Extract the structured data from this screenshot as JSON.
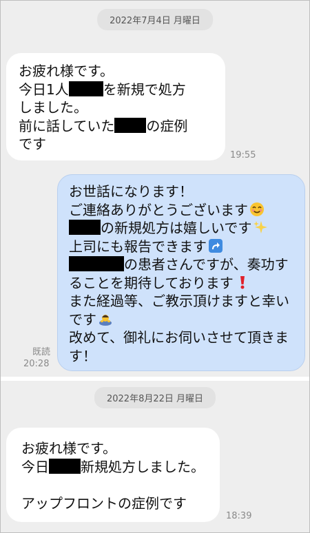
{
  "dates": {
    "first": "2022年7月4日 月曜日",
    "second": "2022年8月22日 月曜日"
  },
  "msg1": {
    "line1": "お疲れ様です。",
    "line2_pre": "今日1人",
    "line2_post": "を新規で処方",
    "line3": "しました。",
    "line4_pre": "前に話していた",
    "line4_post": "の症例",
    "line5": "です",
    "time": "19:55"
  },
  "msg2": {
    "line1": "お世話になります！",
    "line2": "ご連絡ありがとうございます",
    "line3_post": "の新規処方は嬉しいです",
    "line4": "上司にも報告できます",
    "line5_post": "の患者さんですが、奏功す",
    "line6": "ることを期待しております",
    "line7": "また経過等、ご教示頂けますと幸い",
    "line8": "です",
    "line9": "改めて、御礼にお伺いさせて頂きま",
    "line10": "す！",
    "read_label": "既読",
    "time": "20:28"
  },
  "msg3": {
    "line1": "お疲れ様です。",
    "line2_pre": "今日",
    "line2_post": "新規処方しました。",
    "line4": "アップフロントの症例です",
    "time": "18:39"
  },
  "icons": {
    "smile": "smiling-face-emoji",
    "sparkles": "sparkles-emoji",
    "arrow": "arrow-up-right-emoji",
    "exclamation": "red-exclamation-emoji",
    "bow": "bowing-person-emoji"
  }
}
